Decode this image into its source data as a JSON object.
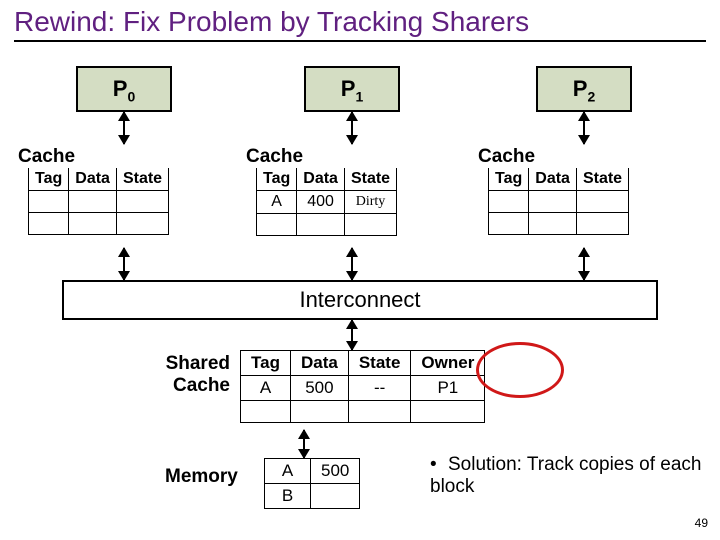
{
  "title": "Rewind: Fix Problem by Tracking Sharers",
  "processors": {
    "p0": "P",
    "p0sub": "0",
    "p1": "P",
    "p1sub": "1",
    "p2": "P",
    "p2sub": "2"
  },
  "cache_label": "Cache",
  "cache_headers": {
    "tag": "Tag",
    "data": "Data",
    "state": "State"
  },
  "caches": {
    "p0": {
      "rows": [
        {
          "tag": "",
          "data": "",
          "state": ""
        },
        {
          "tag": "",
          "data": "",
          "state": ""
        }
      ]
    },
    "p1": {
      "rows": [
        {
          "tag": "A",
          "data": "400",
          "state": "Dirty"
        },
        {
          "tag": "",
          "data": "",
          "state": ""
        }
      ]
    },
    "p2": {
      "rows": [
        {
          "tag": "",
          "data": "",
          "state": ""
        },
        {
          "tag": "",
          "data": "",
          "state": ""
        }
      ]
    }
  },
  "interconnect": "Interconnect",
  "shared_cache_label_l1": "Shared",
  "shared_cache_label_l2": "Cache",
  "shared_headers": {
    "tag": "Tag",
    "data": "Data",
    "state": "State",
    "owner": "Owner"
  },
  "shared_rows": [
    {
      "tag": "A",
      "data": "500",
      "state": "--",
      "owner": "P1"
    },
    {
      "tag": "",
      "data": "",
      "state": "",
      "owner": ""
    }
  ],
  "memory_label": "Memory",
  "memory_rows": [
    {
      "addr": "A",
      "data": "500"
    },
    {
      "addr": "B",
      "data": ""
    }
  ],
  "bullet_text": "Solution: Track copies of each block",
  "slide_number": "49"
}
